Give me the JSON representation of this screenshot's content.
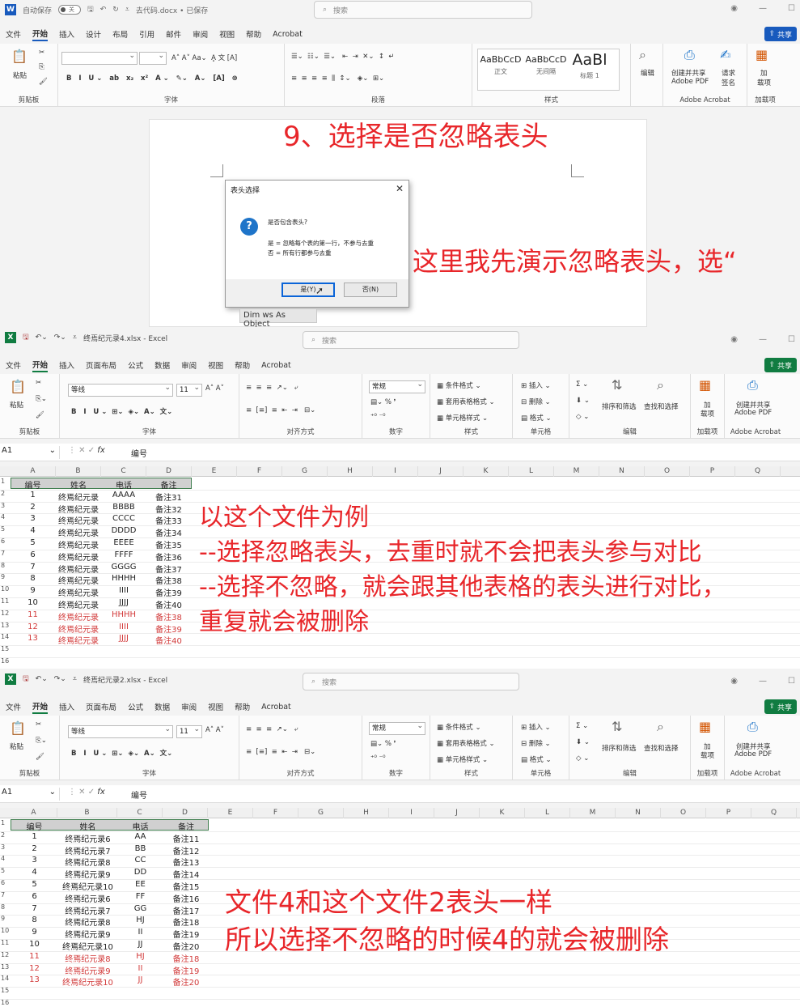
{
  "word": {
    "autosave_label": "自动保存",
    "autosave_state": "关",
    "filename": "去代码.docx • 已保存",
    "search_placeholder": "搜索",
    "menu": [
      "文件",
      "开始",
      "插入",
      "设计",
      "布局",
      "引用",
      "邮件",
      "审阅",
      "视图",
      "帮助",
      "Acrobat"
    ],
    "share": "共享",
    "ribbon": {
      "clipboard": {
        "paste": "粘贴",
        "label": "剪贴板"
      },
      "font": {
        "label": "字体"
      },
      "paragraph": {
        "label": "段落"
      },
      "styles": {
        "label": "样式",
        "items": [
          {
            "preview": "AaBbCcD",
            "name": "正文"
          },
          {
            "preview": "AaBbCcD",
            "name": "无间隔"
          },
          {
            "preview": "AaBl",
            "name": "标题 1"
          }
        ]
      },
      "edit": {
        "label": "编辑"
      },
      "acrobat": {
        "create": "创建并共享",
        "create2": "Adobe PDF",
        "request": "请求",
        "request2": "签名",
        "label": "Adobe Acrobat"
      },
      "addins": {
        "label1": "加",
        "label2": "载项",
        "label": "加载项"
      }
    },
    "dialog": {
      "title": "表头选择",
      "question": "是否包含表头?",
      "line_yes": "是 = 忽略每个表的第一行，不参与去重",
      "line_no": "否 = 所有行都参与去重",
      "btn_yes": "是(Y)",
      "btn_no": "否(N)"
    },
    "tooltip": "Dim ws As Object"
  },
  "captions": {
    "step": "9、选择是否忽略表头",
    "demo": "这里我先演示忽略表头，选“",
    "excel1_lines": [
      "以这个文件为例",
      "--选择忽略表头，去重时就不会把表头参与对比",
      "--选择不忽略，就会跟其他表格的表头进行对比，",
      "重复就会被删除"
    ],
    "excel2_lines": [
      "文件4和这个文件2表头一样",
      "所以选择不忽略的时候4的就会被删除"
    ]
  },
  "excel1": {
    "filename": "终焉纪元录4.xlsx  -  Excel",
    "search_placeholder": "搜索",
    "menu": [
      "文件",
      "开始",
      "插入",
      "页面布局",
      "公式",
      "数据",
      "审阅",
      "视图",
      "帮助",
      "Acrobat"
    ],
    "share": "共享",
    "font_name": "等线",
    "font_size": "11",
    "number_format": "常规",
    "cell_ref": "A1",
    "formula": "编号",
    "ribbon": {
      "clip": "剪贴板",
      "font": "字体",
      "align": "对齐方式",
      "number": "数字",
      "styles": "样式",
      "cells": "单元格",
      "edit": "编辑",
      "addins": "加载项",
      "acrobat": "Adobe Acrobat",
      "cond": "条件格式",
      "table": "套用表格格式",
      "cellstyle": "单元格样式",
      "insert": "插入",
      "delete": "删除",
      "format": "格式",
      "sort": "排序和筛选",
      "find": "查找和选择",
      "paste": "粘贴",
      "addin1": "加",
      "addin2": "载项",
      "pdf1": "创建并共享",
      "pdf2": "Adobe PDF"
    },
    "columns": [
      "A",
      "B",
      "C",
      "D",
      "E",
      "F",
      "G",
      "H",
      "I",
      "J",
      "K",
      "L",
      "M",
      "N",
      "O",
      "P",
      "Q"
    ],
    "header": [
      "编号",
      "姓名",
      "电话",
      "备注"
    ],
    "rows": [
      [
        "1",
        "终焉纪元录",
        "AAAA",
        "备注31"
      ],
      [
        "2",
        "终焉纪元录",
        "BBBB",
        "备注32"
      ],
      [
        "3",
        "终焉纪元录",
        "CCCC",
        "备注33"
      ],
      [
        "4",
        "终焉纪元录",
        "DDDD",
        "备注34"
      ],
      [
        "5",
        "终焉纪元录",
        "EEEE",
        "备注35"
      ],
      [
        "6",
        "终焉纪元录",
        "FFFF",
        "备注36"
      ],
      [
        "7",
        "终焉纪元录",
        "GGGG",
        "备注37"
      ],
      [
        "8",
        "终焉纪元录",
        "HHHH",
        "备注38"
      ],
      [
        "9",
        "终焉纪元录",
        "IIII",
        "备注39"
      ],
      [
        "10",
        "终焉纪元录",
        "JJJJ",
        "备注40"
      ],
      [
        "11",
        "终焉纪元录",
        "HHHH",
        "备注38"
      ],
      [
        "12",
        "终焉纪元录",
        "IIII",
        "备注39"
      ],
      [
        "13",
        "终焉纪元录",
        "JJJJ",
        "备注40"
      ]
    ],
    "dup_from_row": 10
  },
  "excel2": {
    "filename": "终焉纪元录2.xlsx  -  Excel",
    "search_placeholder": "搜索",
    "menu": [
      "文件",
      "开始",
      "插入",
      "页面布局",
      "公式",
      "数据",
      "审阅",
      "视图",
      "帮助",
      "Acrobat"
    ],
    "share": "共享",
    "font_name": "等线",
    "font_size": "11",
    "number_format": "常规",
    "cell_ref": "A1",
    "formula": "编号",
    "ribbon": {
      "clip": "剪贴板",
      "font": "字体",
      "align": "对齐方式",
      "number": "数字",
      "styles": "样式",
      "cells": "单元格",
      "edit": "编辑",
      "addins": "加载项",
      "acrobat": "Adobe Acrobat",
      "cond": "条件格式",
      "table": "套用表格格式",
      "cellstyle": "单元格样式",
      "insert": "插入",
      "delete": "删除",
      "format": "格式",
      "sort": "排序和筛选",
      "find": "查找和选择",
      "paste": "粘贴",
      "addin1": "加",
      "addin2": "载项",
      "pdf1": "创建并共享",
      "pdf2": "Adobe PDF"
    },
    "columns": [
      "A",
      "B",
      "C",
      "D",
      "E",
      "F",
      "G",
      "H",
      "I",
      "J",
      "K",
      "L",
      "M",
      "N",
      "O",
      "P",
      "Q"
    ],
    "header": [
      "编号",
      "姓名",
      "电话",
      "备注"
    ],
    "rows": [
      [
        "1",
        "终焉纪元录6",
        "AA",
        "备注11"
      ],
      [
        "2",
        "终焉纪元录7",
        "BB",
        "备注12"
      ],
      [
        "3",
        "终焉纪元录8",
        "CC",
        "备注13"
      ],
      [
        "4",
        "终焉纪元录9",
        "DD",
        "备注14"
      ],
      [
        "5",
        "终焉纪元录10",
        "EE",
        "备注15"
      ],
      [
        "6",
        "终焉纪元录6",
        "FF",
        "备注16"
      ],
      [
        "7",
        "终焉纪元录7",
        "GG",
        "备注17"
      ],
      [
        "8",
        "终焉纪元录8",
        "HJ",
        "备注18"
      ],
      [
        "9",
        "终焉纪元录9",
        "II",
        "备注19"
      ],
      [
        "10",
        "终焉纪元录10",
        "JJ",
        "备注20"
      ],
      [
        "11",
        "终焉纪元录8",
        "HJ",
        "备注18"
      ],
      [
        "12",
        "终焉纪元录9",
        "II",
        "备注19"
      ],
      [
        "13",
        "终焉纪元录10",
        "JJ",
        "备注20"
      ]
    ],
    "dup_from_row": 10
  }
}
